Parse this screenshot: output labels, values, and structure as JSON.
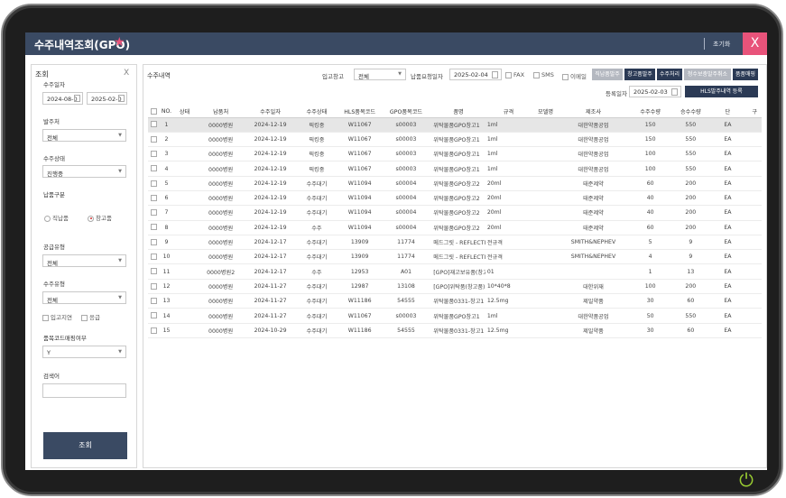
{
  "window": {
    "title": "수주내역조회(GPO)",
    "reset_label": "초기화",
    "close_label": "X"
  },
  "filter": {
    "heading": "조회",
    "close_label": "X",
    "order_date_label": "수주일자",
    "date_from": "2024-08-0",
    "date_to": "2025-02-0",
    "ordering_party_label": "발주처",
    "ordering_party_value": "전체",
    "order_status_label": "수주상태",
    "order_status_value": "진행중",
    "delivery_type_label": "납품구분",
    "delivery_direct": "직납품",
    "delivery_warehouse": "창고품",
    "delivery_selected": "창고품",
    "supply_type_label": "공급유형",
    "supply_type_value": "전체",
    "order_type_label": "수주유형",
    "order_type_value": "전체",
    "check_stock_delay": "입고지연",
    "check_urgent": "응급",
    "product_mapping_label": "품목코드매핑여부",
    "product_mapping_value": "Y",
    "keyword_label": "검색어",
    "keyword_value": "",
    "search_button": "조회"
  },
  "toolbar": {
    "section_label": "수주내역",
    "warehouse_label": "입고창고",
    "warehouse_value": "전체",
    "delivery_date_label": "납품요청일자",
    "delivery_date_value": "2025-02-04",
    "fax_label": "FAX",
    "sms_label": "SMS",
    "email_label": "이메일",
    "btn_direct_order": "직납품발주",
    "btn_warehouse_order": "창고품발주",
    "btn_process_order": "수주처리",
    "btn_cancel_request": "청수보충발주취소",
    "btn_mapping": "품품매핑",
    "reg_date_label": "등록일자",
    "reg_date_value": "2025-02-03",
    "btn_hls_register": "HLS발주내역 등록"
  },
  "table": {
    "columns": [
      "NO.",
      "상태",
      "납품처",
      "수주일자",
      "수주상태",
      "HLS품목코드",
      "GPO품목코드",
      "품명",
      "규격",
      "모델명",
      "제조사",
      "수주수량",
      "승수수량",
      "단",
      "구"
    ],
    "rows": [
      [
        "1",
        "",
        "0000병원",
        "2024-12-19",
        "픽킹중",
        "W11067",
        "s00003",
        "위탁물품GPO창고1",
        "1ml",
        "",
        "대한약품공업",
        "150",
        "550",
        "EA"
      ],
      [
        "2",
        "",
        "0000병원",
        "2024-12-19",
        "픽킹중",
        "W11067",
        "s00003",
        "위탁물품GPO창고1",
        "1ml",
        "",
        "대한약품공업",
        "150",
        "550",
        "EA"
      ],
      [
        "3",
        "",
        "0000병원",
        "2024-12-19",
        "픽킹중",
        "W11067",
        "s00003",
        "위탁물품GPO창고1",
        "1ml",
        "",
        "대한약품공업",
        "100",
        "550",
        "EA"
      ],
      [
        "4",
        "",
        "0000병원",
        "2024-12-19",
        "픽킹중",
        "W11067",
        "s00003",
        "위탁물품GPO창고1",
        "1ml",
        "",
        "대한약품공업",
        "100",
        "550",
        "EA"
      ],
      [
        "5",
        "",
        "0000병원",
        "2024-12-19",
        "수주대기",
        "W11094",
        "s00004",
        "위탁물품GPO창고2",
        "20ml",
        "",
        "태준제약",
        "60",
        "200",
        "EA"
      ],
      [
        "6",
        "",
        "0000병원",
        "2024-12-19",
        "수주대기",
        "W11094",
        "s00004",
        "위탁물품GPO창고2",
        "20ml",
        "",
        "태준제약",
        "40",
        "200",
        "EA"
      ],
      [
        "7",
        "",
        "0000병원",
        "2024-12-19",
        "수주대기",
        "W11094",
        "s00004",
        "위탁물품GPO창고2",
        "20ml",
        "",
        "태준제약",
        "40",
        "200",
        "EA"
      ],
      [
        "8",
        "",
        "0000병원",
        "2024-12-19",
        "수주",
        "W11094",
        "s00004",
        "위탁물품GPO창고2",
        "20ml",
        "",
        "태준제약",
        "60",
        "200",
        "EA"
      ],
      [
        "9",
        "",
        "0000병원",
        "2024-12-17",
        "수주대기",
        "13909",
        "11774",
        "메드그릿 - REFLECTIC",
        "전규격",
        "",
        "SMITH&NEPHEV",
        "5",
        "9",
        "EA"
      ],
      [
        "10",
        "",
        "0000병원",
        "2024-12-17",
        "수주대기",
        "13909",
        "11774",
        "메드그릿 - REFLECTIC",
        "전규격",
        "",
        "SMITH&NEPHEV",
        "4",
        "9",
        "EA"
      ],
      [
        "11",
        "",
        "0000병원2",
        "2024-12-17",
        "수주",
        "12953",
        "A01",
        "[GPO]재고보유품(창고",
        "01",
        "",
        "",
        "1",
        "13",
        "EA"
      ],
      [
        "12",
        "",
        "0000병원",
        "2024-11-27",
        "수주대기",
        "12987",
        "13108",
        "[GPO]위탁품(창고품)",
        "10*40*8",
        "",
        "대한위재",
        "100",
        "200",
        "EA"
      ],
      [
        "13",
        "",
        "0000병원",
        "2024-11-27",
        "수주대기",
        "W11186",
        "54555",
        "위탁물품0331-창고1",
        "12.5mg",
        "",
        "제일약품",
        "30",
        "60",
        "EA"
      ],
      [
        "14",
        "",
        "0000병원",
        "2024-11-27",
        "수주대기",
        "W11067",
        "s00003",
        "위탁물품GPO창고1",
        "1ml",
        "",
        "대한약품공업",
        "50",
        "550",
        "EA"
      ],
      [
        "15",
        "",
        "0000병원",
        "2024-10-29",
        "수주대기",
        "W11186",
        "54555",
        "위탁물품0331-창고1",
        "12.5mg",
        "",
        "제일약품",
        "30",
        "60",
        "EA"
      ]
    ]
  },
  "colors": {
    "header": "#3a4a63",
    "accent_pink": "#e8537a",
    "button_navy": "#2b3a55",
    "selected_row": "#e6e6e6"
  }
}
